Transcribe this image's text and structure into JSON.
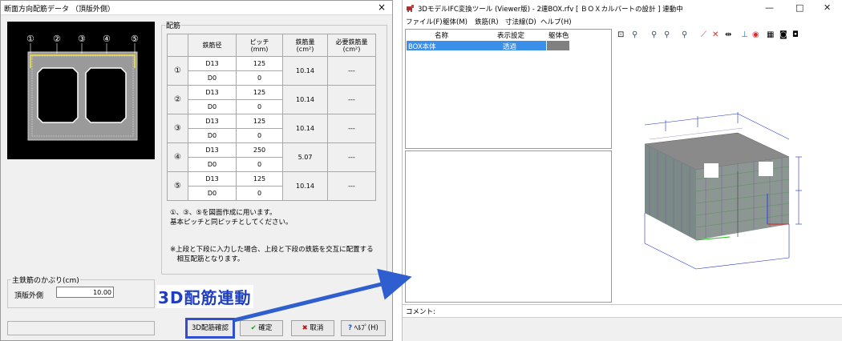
{
  "dialog": {
    "title": "断面方向配筋データ （頂版外側）",
    "close_glyph": "×",
    "preview_markers": [
      "①",
      "②",
      "③",
      "④",
      "⑤"
    ],
    "rebar_group_label": "配筋",
    "table_headers": [
      "鉄筋径",
      "ピッチ\n(mm)",
      "鉄筋量\n(cm²)",
      "必要鉄筋量\n(cm²)"
    ],
    "rows": [
      {
        "no": "①",
        "d1": "D13",
        "p1": "125",
        "d2": "D0",
        "p2": "0",
        "amount": "10.14",
        "required": "---"
      },
      {
        "no": "②",
        "d1": "D13",
        "p1": "125",
        "d2": "D0",
        "p2": "0",
        "amount": "10.14",
        "required": "---"
      },
      {
        "no": "③",
        "d1": "D13",
        "p1": "125",
        "d2": "D0",
        "p2": "0",
        "amount": "10.14",
        "required": "---"
      },
      {
        "no": "④",
        "d1": "D13",
        "p1": "250",
        "d2": "D0",
        "p2": "0",
        "amount": "5.07",
        "required": "---"
      },
      {
        "no": "⑤",
        "d1": "D13",
        "p1": "125",
        "d2": "D0",
        "p2": "0",
        "amount": "10.14",
        "required": "---"
      }
    ],
    "note1_line1": "①、③、⑤を図面作成に用います。",
    "note1_line2": "基本ピッチと同ピッチとしてください。",
    "note2_line1": "※上段と下段に入力した場合、上段と下段の鉄筋を交互に配置する",
    "note2_line2": "　相互配筋となります。",
    "cover_group_label": "主鉄筋のかぶり(cm)",
    "cover_label": "頂版外側",
    "cover_value": "10.00",
    "callout": "3D配筋連動",
    "btn_3d": "3D配筋確認",
    "btn_ok_icon": "✔",
    "btn_ok": "確定",
    "btn_cancel_icon": "✖",
    "btn_cancel": "取消",
    "btn_help_icon": "?",
    "btn_help": "ﾍﾙﾌﾟ(H)"
  },
  "viewer": {
    "title": "3DモデルIFC変換ツール (Viewer版) - 2連BOX.rfv [ ＢＯＸカルバートの設計 ] 連動中",
    "min_glyph": "—",
    "max_glyph": "□",
    "close_glyph": "✕",
    "menu": [
      "ファイル(F)",
      "躯体(M)",
      "鉄筋(R)",
      "寸法線(D)",
      "ヘルプ(H)"
    ],
    "list_headers": [
      "名称",
      "表示設定",
      "躯体色"
    ],
    "list_row": {
      "name": "BOX本体",
      "display": "透過"
    },
    "comment_label": "コメント:"
  },
  "colors": {
    "callout": "#1f3fbf",
    "selection": "#3a8fe8",
    "swatch": "#808080",
    "arrow": "#2f5fcf"
  }
}
